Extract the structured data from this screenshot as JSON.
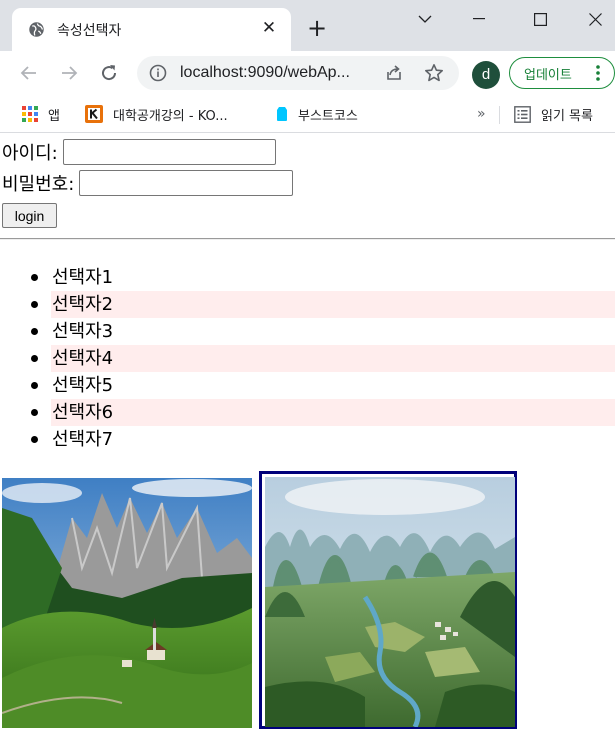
{
  "browser": {
    "tab_title": "속성선택자",
    "tab_close": "✕",
    "new_tab": "+",
    "url": "localhost:9090/webAp...",
    "avatar_initial": "d",
    "update_label": "업데이트",
    "bookmarks": {
      "apps": "앱",
      "kocw": "대학공개강의 - KO...",
      "boost": "부스트코스",
      "more": "»",
      "reading_list": "읽기 목록"
    }
  },
  "form": {
    "id_label": "아이디:",
    "id_value": "",
    "pw_label": "비밀번호:",
    "pw_value": "",
    "login_label": "login"
  },
  "list": {
    "items": [
      {
        "label": "선택자1",
        "highlighted": false
      },
      {
        "label": "선택자2",
        "highlighted": true
      },
      {
        "label": "선택자3",
        "highlighted": false
      },
      {
        "label": "선택자4",
        "highlighted": true
      },
      {
        "label": "선택자5",
        "highlighted": false
      },
      {
        "label": "선택자6",
        "highlighted": true
      },
      {
        "label": "선택자7",
        "highlighted": false
      }
    ],
    "highlight_color": "#ffeded"
  },
  "images": [
    {
      "name": "mountain-meadow-image",
      "bordered": false
    },
    {
      "name": "karst-valley-image",
      "bordered": true,
      "border_color": "#00007a"
    }
  ],
  "colors": {
    "chrome_bg": "#dee1e6",
    "update_green": "#188038"
  }
}
